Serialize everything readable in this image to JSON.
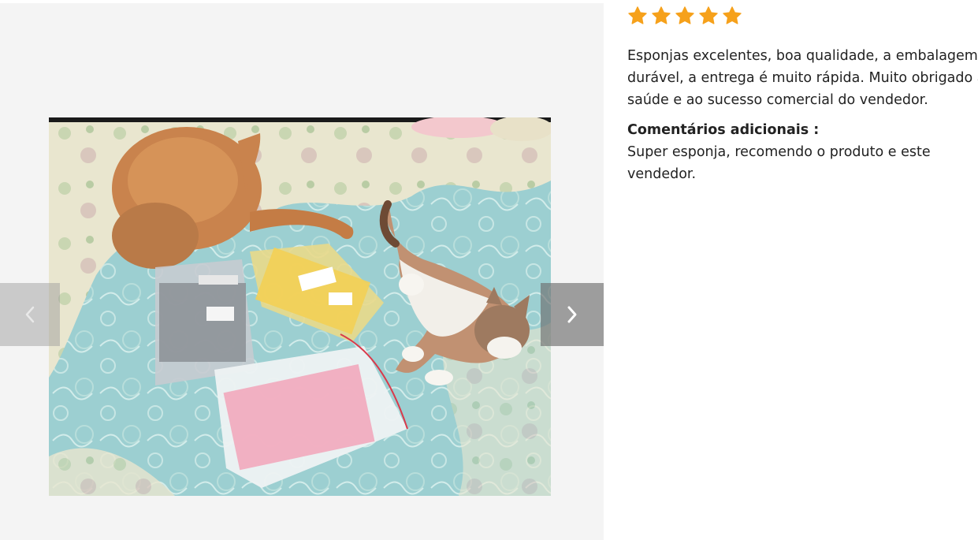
{
  "review": {
    "rating": 5,
    "rating_max": 5,
    "star_color": "#f6a11b",
    "text_lines": [
      "Esponjas excelentes, boa qualidade, a embalagem é",
      "durável, a entrega é muito rápida. Muito obrigado à",
      "saúde e ao sucesso comercial do vendedor."
    ],
    "additional_heading": "Comentários adicionais :",
    "additional_text": "Super esponja, recomendo o produto e este vendedor."
  },
  "gallery": {
    "prev_icon": "chevron-left-icon",
    "next_icon": "chevron-right-icon"
  }
}
